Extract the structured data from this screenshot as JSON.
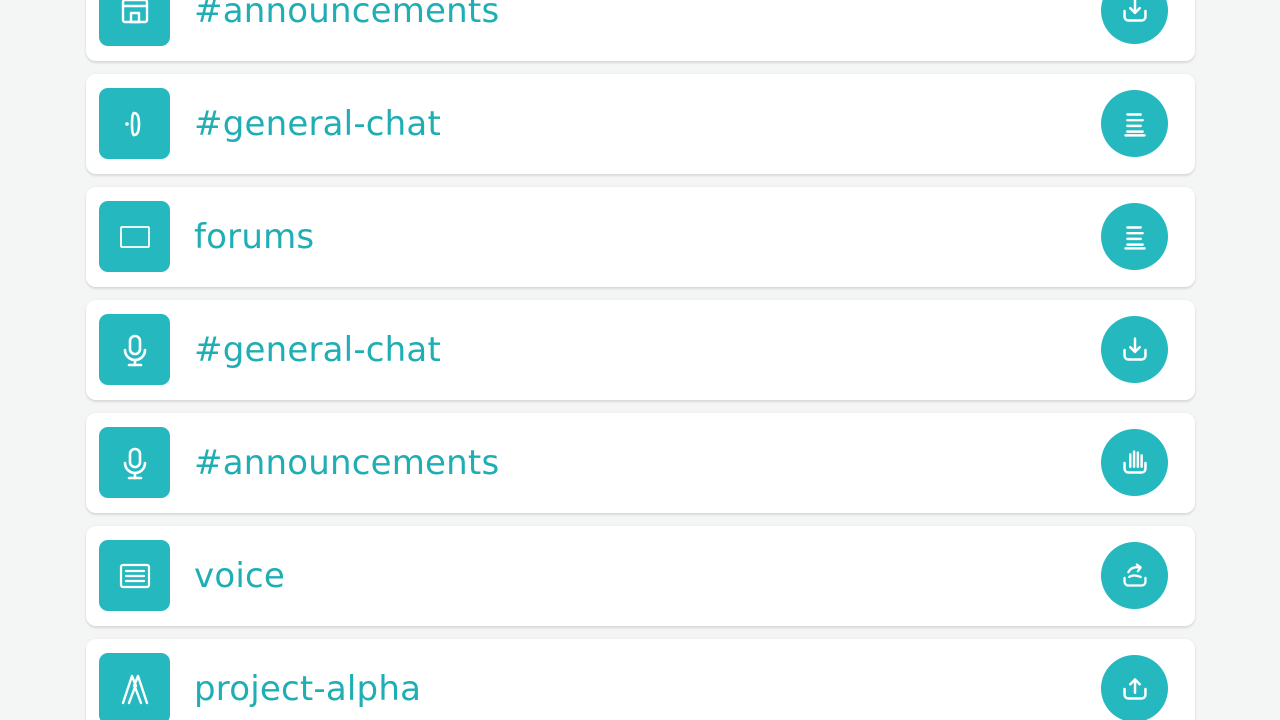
{
  "colors": {
    "accent": "#25b9bf",
    "label": "#1faeb4",
    "card": "#ffffff",
    "background": "#f4f5f5"
  },
  "channels": [
    {
      "label": "#announcements",
      "icon": "folder-icon",
      "action_icon": "download-icon"
    },
    {
      "label": "#general-chat",
      "icon": "chat-bubble-icon",
      "action_icon": "list-icon"
    },
    {
      "label": "forums",
      "icon": "screen-icon",
      "action_icon": "list-icon"
    },
    {
      "label": "#general-chat",
      "icon": "microphone-icon",
      "action_icon": "download-icon"
    },
    {
      "label": "#announcements",
      "icon": "microphone-icon",
      "action_icon": "hand-icon"
    },
    {
      "label": "voice",
      "icon": "document-icon",
      "action_icon": "share-icon"
    },
    {
      "label": "project-alpha",
      "icon": "alpha-icon",
      "action_icon": "upload-icon"
    }
  ]
}
